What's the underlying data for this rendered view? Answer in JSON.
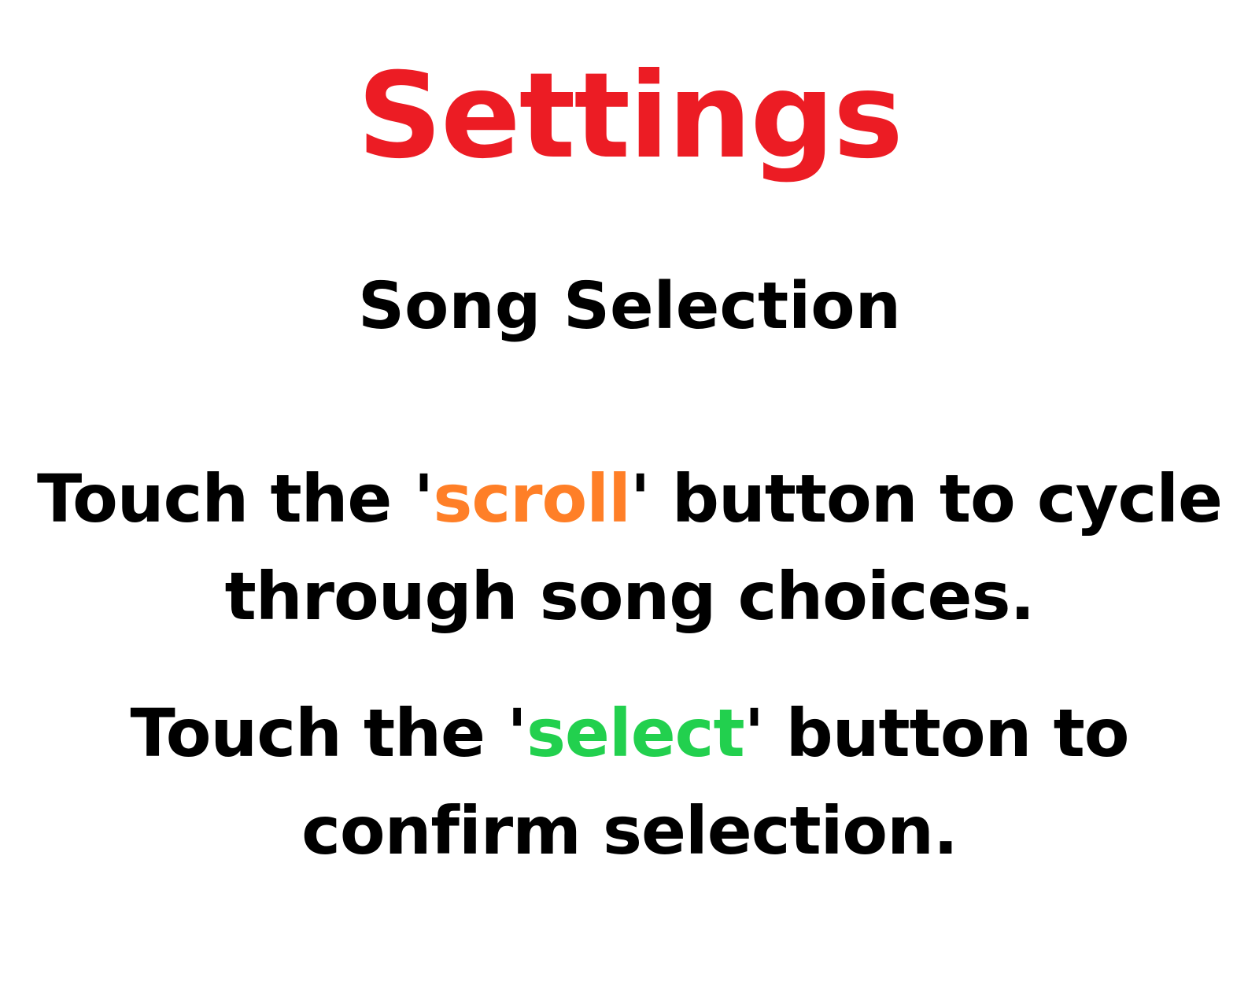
{
  "colors": {
    "background": "#ffffff",
    "title": "#ec1c24",
    "text": "#000000",
    "scroll_keyword": "#ff7f27",
    "select_keyword": "#22d04e"
  },
  "title": "Settings",
  "subtitle": "Song Selection",
  "instructions": [
    {
      "line1_before": "Touch the '",
      "keyword": "scroll",
      "line1_after": "' button to cycle",
      "line2": "through song choices."
    },
    {
      "line1_before": "Touch the '",
      "keyword": "select",
      "line1_after": "' button to",
      "line2": "confirm selection."
    }
  ]
}
